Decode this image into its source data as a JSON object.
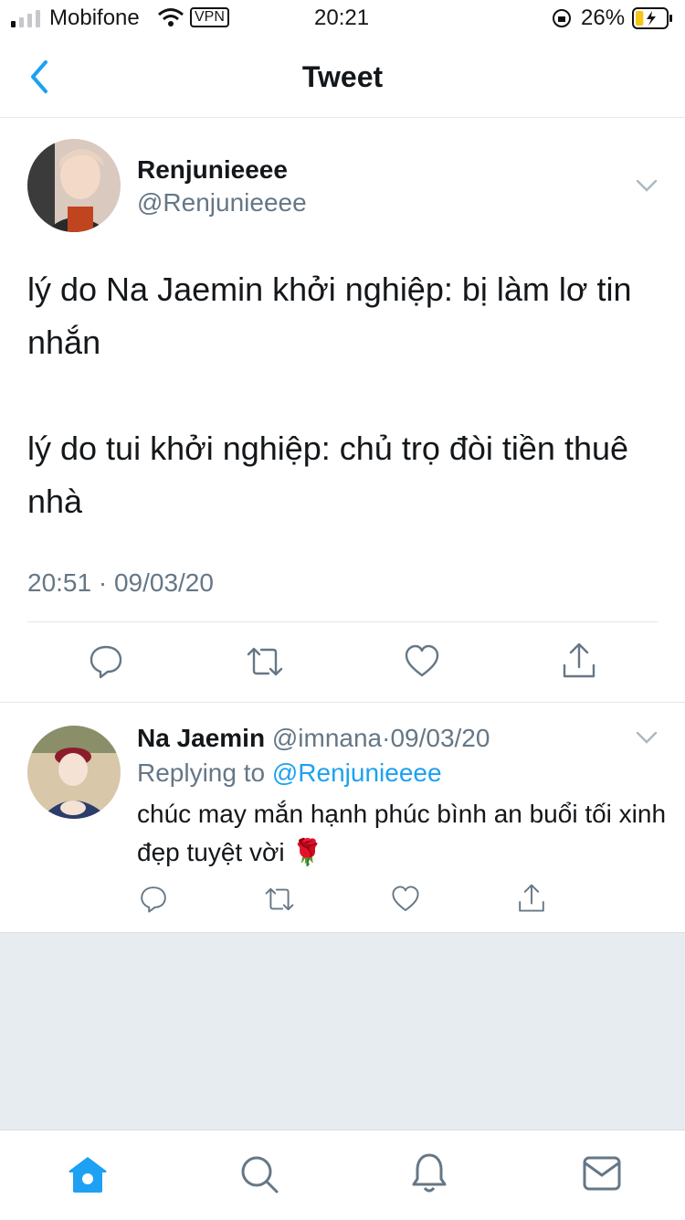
{
  "status_bar": {
    "carrier": "Mobifone",
    "vpn": "VPN",
    "time": "20:21",
    "battery": "26%",
    "battery_level": 0.26
  },
  "nav": {
    "title": "Tweet"
  },
  "tweet": {
    "name": "Renjunieeee",
    "handle": "@Renjunieeee",
    "text": "lý do Na Jaemin khởi nghiệp: bị làm lơ tin nhắn\n\nlý do tui khởi nghiệp: chủ trọ đòi tiền thuê nhà",
    "timestamp": "20:51 · 09/03/20"
  },
  "reply": {
    "name": "Na Jaemin",
    "handle": "@imnana",
    "separator": "·",
    "date": "09/03/20",
    "replying_prefix": "Replying to",
    "replying_handle": "@Renjunieeee",
    "text": "chúc may mắn hạnh phúc bình an buổi tối xinh đẹp tuyệt vời 🌹"
  },
  "icons": {
    "reply": "reply-icon",
    "retweet": "retweet-icon",
    "like": "like-icon",
    "share": "share-icon",
    "home": "home-icon",
    "search": "search-icon",
    "notifications": "bell-icon",
    "messages": "mail-icon"
  },
  "colors": {
    "accent": "#1da1f2",
    "muted": "#657786",
    "text": "#14171a",
    "battery": "#f5c518"
  }
}
